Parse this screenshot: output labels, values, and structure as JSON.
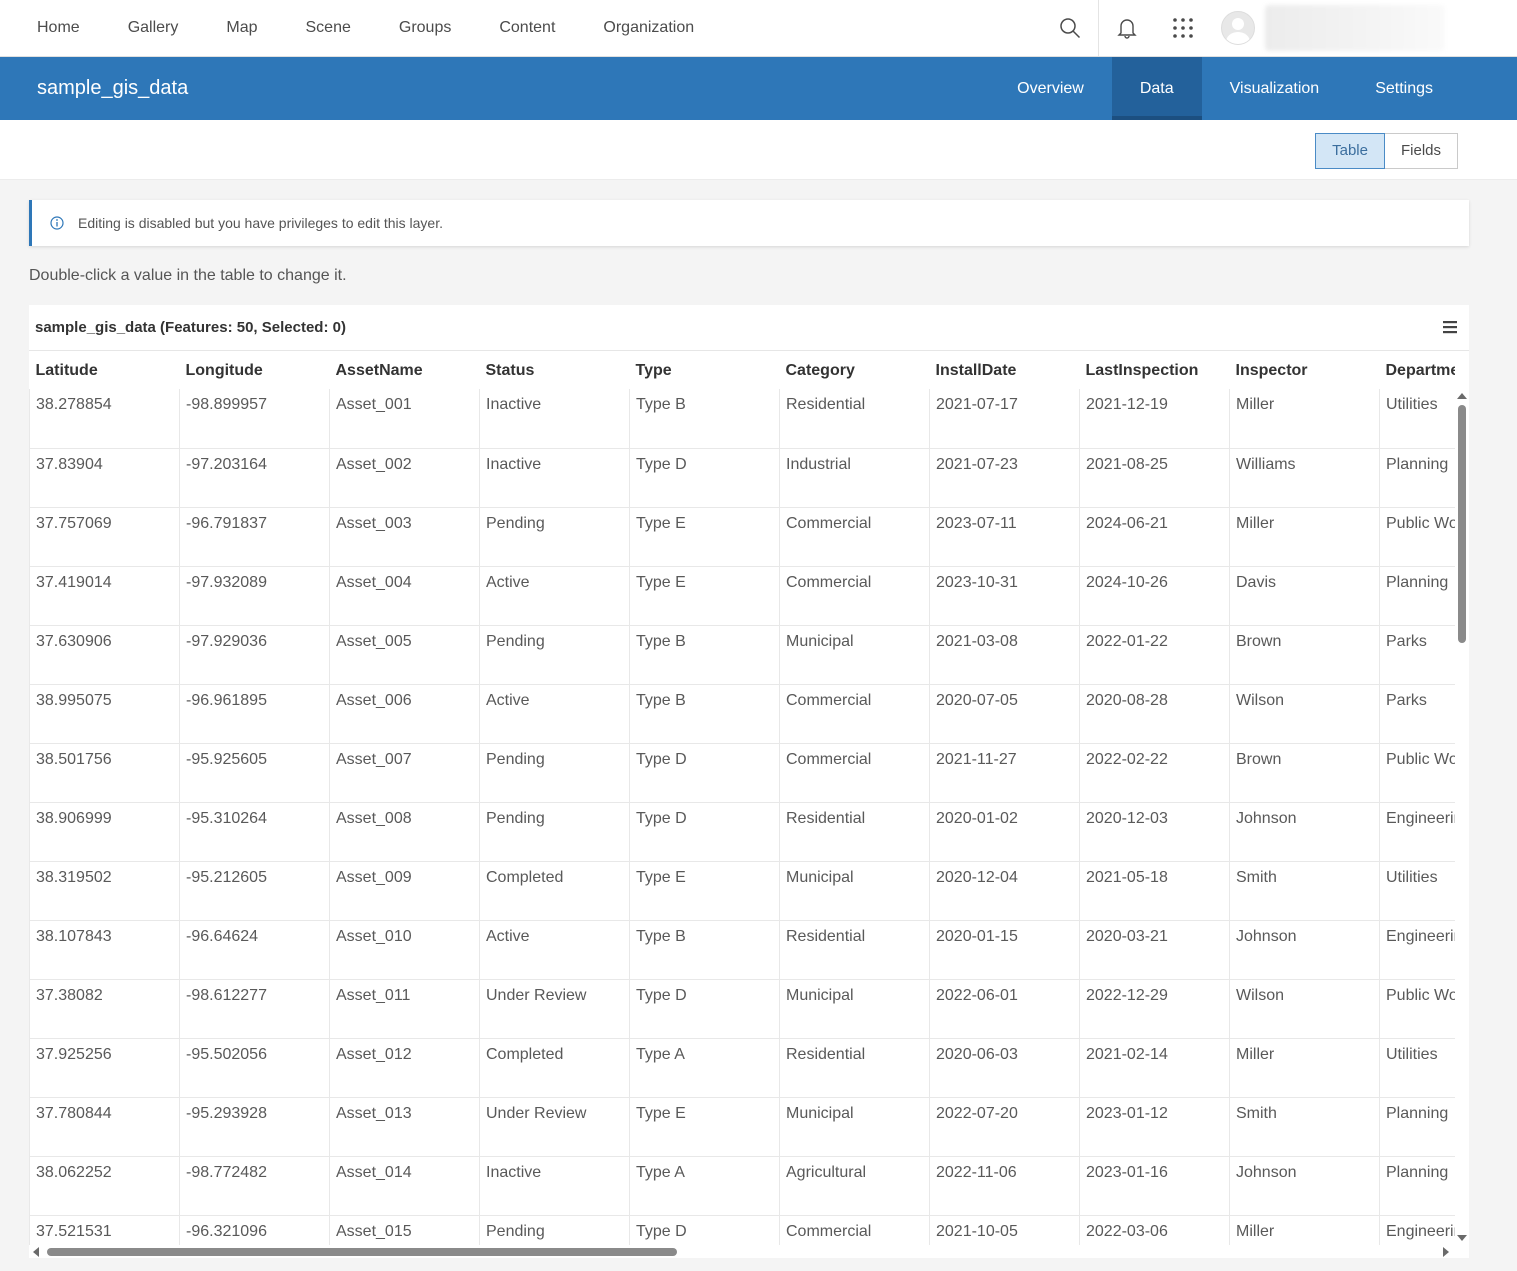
{
  "nav": {
    "links": [
      "Home",
      "Gallery",
      "Map",
      "Scene",
      "Groups",
      "Content",
      "Organization"
    ]
  },
  "header": {
    "title": "sample_gis_data",
    "tabs": [
      {
        "label": "Overview",
        "active": false
      },
      {
        "label": "Data",
        "active": true
      },
      {
        "label": "Visualization",
        "active": false
      },
      {
        "label": "Settings",
        "active": false
      }
    ]
  },
  "viewbar": {
    "table_label": "Table",
    "fields_label": "Fields",
    "selected": "Table"
  },
  "notice": {
    "text": "Editing is disabled but you have privileges to edit this layer."
  },
  "hint": "Double-click a value in the table to change it.",
  "table": {
    "title": "sample_gis_data (Features: 50, Selected: 0)",
    "columns": [
      "Latitude",
      "Longitude",
      "AssetName",
      "Status",
      "Type",
      "Category",
      "InstallDate",
      "LastInspection",
      "Inspector",
      "Department"
    ],
    "rows": [
      [
        "38.278854",
        "-98.899957",
        "Asset_001",
        "Inactive",
        "Type B",
        "Residential",
        "2021-07-17",
        "2021-12-19",
        "Miller",
        "Utilities"
      ],
      [
        "37.83904",
        "-97.203164",
        "Asset_002",
        "Inactive",
        "Type D",
        "Industrial",
        "2021-07-23",
        "2021-08-25",
        "Williams",
        "Planning"
      ],
      [
        "37.757069",
        "-96.791837",
        "Asset_003",
        "Pending",
        "Type E",
        "Commercial",
        "2023-07-11",
        "2024-06-21",
        "Miller",
        "Public Works"
      ],
      [
        "37.419014",
        "-97.932089",
        "Asset_004",
        "Active",
        "Type E",
        "Commercial",
        "2023-10-31",
        "2024-10-26",
        "Davis",
        "Planning"
      ],
      [
        "37.630906",
        "-97.929036",
        "Asset_005",
        "Pending",
        "Type B",
        "Municipal",
        "2021-03-08",
        "2022-01-22",
        "Brown",
        "Parks"
      ],
      [
        "38.995075",
        "-96.961895",
        "Asset_006",
        "Active",
        "Type B",
        "Commercial",
        "2020-07-05",
        "2020-08-28",
        "Wilson",
        "Parks"
      ],
      [
        "38.501756",
        "-95.925605",
        "Asset_007",
        "Pending",
        "Type D",
        "Commercial",
        "2021-11-27",
        "2022-02-22",
        "Brown",
        "Public Works"
      ],
      [
        "38.906999",
        "-95.310264",
        "Asset_008",
        "Pending",
        "Type D",
        "Residential",
        "2020-01-02",
        "2020-12-03",
        "Johnson",
        "Engineering"
      ],
      [
        "38.319502",
        "-95.212605",
        "Asset_009",
        "Completed",
        "Type E",
        "Municipal",
        "2020-12-04",
        "2021-05-18",
        "Smith",
        "Utilities"
      ],
      [
        "38.107843",
        "-96.64624",
        "Asset_010",
        "Active",
        "Type B",
        "Residential",
        "2020-01-15",
        "2020-03-21",
        "Johnson",
        "Engineering"
      ],
      [
        "37.38082",
        "-98.612277",
        "Asset_011",
        "Under Review",
        "Type D",
        "Municipal",
        "2022-06-01",
        "2022-12-29",
        "Wilson",
        "Public Works"
      ],
      [
        "37.925256",
        "-95.502056",
        "Asset_012",
        "Completed",
        "Type A",
        "Residential",
        "2020-06-03",
        "2021-02-14",
        "Miller",
        "Utilities"
      ],
      [
        "37.780844",
        "-95.293928",
        "Asset_013",
        "Under Review",
        "Type E",
        "Municipal",
        "2022-07-20",
        "2023-01-12",
        "Smith",
        "Planning"
      ],
      [
        "38.062252",
        "-98.772482",
        "Asset_014",
        "Inactive",
        "Type A",
        "Agricultural",
        "2022-11-06",
        "2023-01-16",
        "Johnson",
        "Planning"
      ],
      [
        "37.521531",
        "-96.321096",
        "Asset_015",
        "Pending",
        "Type D",
        "Commercial",
        "2021-10-05",
        "2022-03-06",
        "Miller",
        "Engineering"
      ]
    ]
  },
  "colors": {
    "header_blue": "#2e77b8",
    "active_tab": "#23619b",
    "seg_selected": "#d3e6f6"
  },
  "icons": [
    "search-icon",
    "bell-icon",
    "app-launcher-icon",
    "avatar",
    "info-icon",
    "table-menu-icon"
  ]
}
